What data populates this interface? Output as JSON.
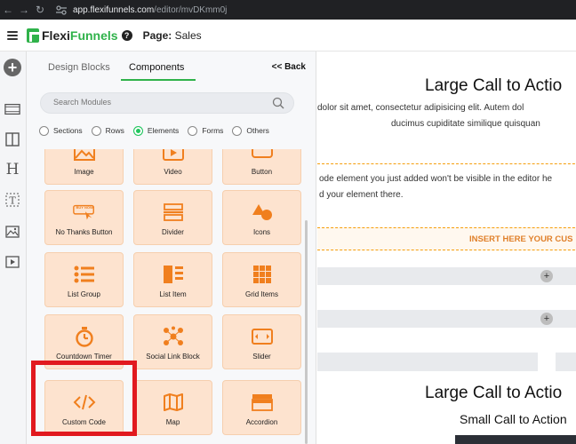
{
  "browser": {
    "url_host": "app.flexifunnels.com",
    "url_path": "/editor/mvDKmm0j"
  },
  "app": {
    "logo_part1": "Flexi",
    "logo_part2": "Funnels",
    "help": "?",
    "page_prefix": "Page:",
    "page_name": "Sales"
  },
  "panel": {
    "tabs": [
      "Design Blocks",
      "Components"
    ],
    "active_tab": "Components",
    "back_label": "<< Back",
    "search_placeholder": "Search Modules",
    "filters": [
      {
        "label": "Sections",
        "selected": false
      },
      {
        "label": "Rows",
        "selected": false
      },
      {
        "label": "Elements",
        "selected": true
      },
      {
        "label": "Forms",
        "selected": false
      },
      {
        "label": "Others",
        "selected": false
      }
    ],
    "tiles": [
      {
        "label": "Image",
        "icon": "image-icon"
      },
      {
        "label": "Video",
        "icon": "video-icon"
      },
      {
        "label": "Button",
        "icon": "button-icon"
      },
      {
        "label": "No Thanks Button",
        "icon": "no-thanks-button-icon",
        "icon_text": "BUY NOW"
      },
      {
        "label": "Divider",
        "icon": "divider-icon"
      },
      {
        "label": "Icons",
        "icon": "shapes-icon"
      },
      {
        "label": "List Group",
        "icon": "list-group-icon"
      },
      {
        "label": "List Item",
        "icon": "list-item-icon"
      },
      {
        "label": "Grid Items",
        "icon": "grid-icon"
      },
      {
        "label": "Countdown Timer",
        "icon": "timer-icon"
      },
      {
        "label": "Social Link Block",
        "icon": "social-icon"
      },
      {
        "label": "Slider",
        "icon": "slider-icon"
      },
      {
        "label": "Custom Code",
        "icon": "code-icon"
      },
      {
        "label": "Map",
        "icon": "map-icon"
      },
      {
        "label": "Accordion",
        "icon": "accordion-icon"
      }
    ]
  },
  "canvas": {
    "heading_1": "Large Call to Actio",
    "para_1": "dolor sit amet, consectetur adipisicing elit. Autem dol",
    "para_2": "ducimus cupiditate similique quisquan",
    "code_note_1": "ode element you just added won't be visible in the editor he",
    "code_note_2": "d your element there.",
    "insert_label": "INSERT HERE YOUR CUS",
    "plus": "+",
    "heading_2": "Large Call to Actio",
    "subheading": "Small Call to Action"
  },
  "colors": {
    "accent_green": "#2fb24a",
    "tile_bg": "#fde3cf",
    "tile_icon": "#f07f1e",
    "highlight_red": "#e1191f"
  }
}
